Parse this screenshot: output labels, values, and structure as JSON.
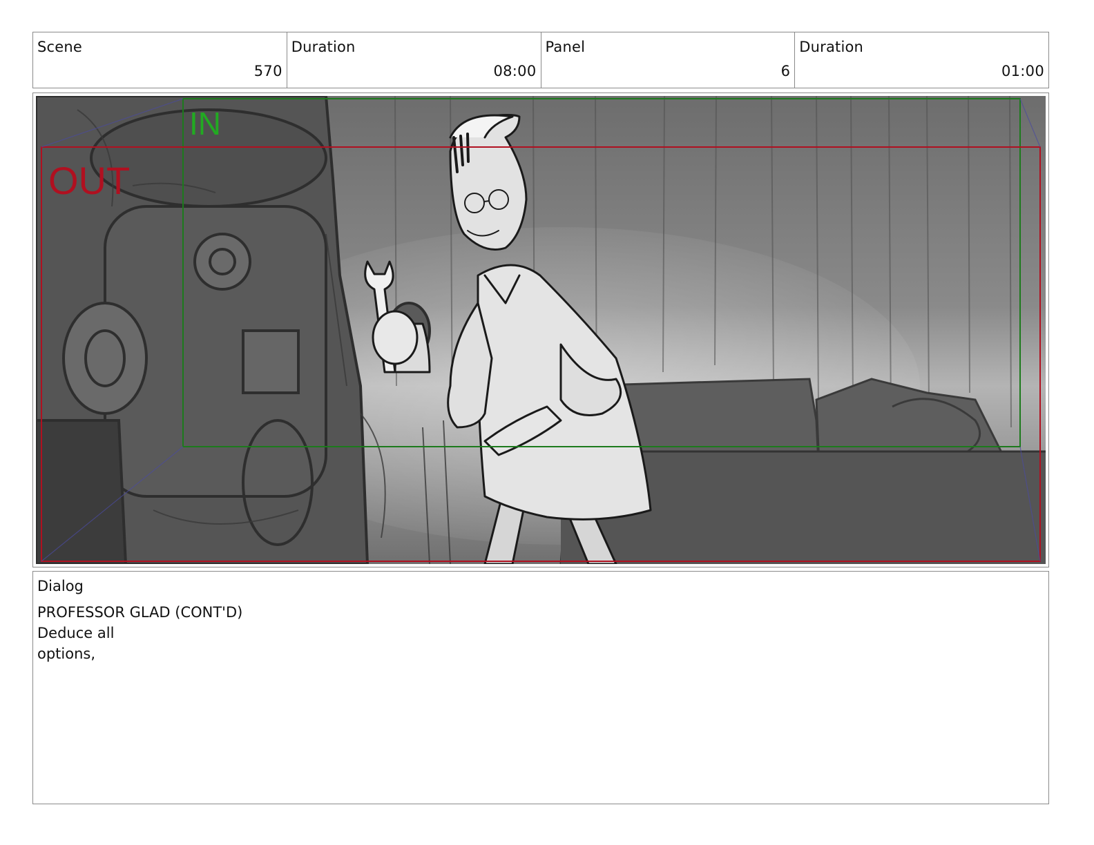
{
  "header": {
    "scene_label": "Scene",
    "scene_value": "570",
    "scene_duration_label": "Duration",
    "scene_duration_value": "08:00",
    "panel_label": "Panel",
    "panel_value": "6",
    "panel_duration_label": "Duration",
    "panel_duration_value": "01:00"
  },
  "frame": {
    "in_label": "IN",
    "out_label": "OUT",
    "in_color": "#22aa22",
    "out_color": "#b01020"
  },
  "dialog": {
    "label": "Dialog",
    "lines": [
      "PROFESSOR GLAD (CONT'D)",
      "Deduce all",
      "options,"
    ]
  }
}
